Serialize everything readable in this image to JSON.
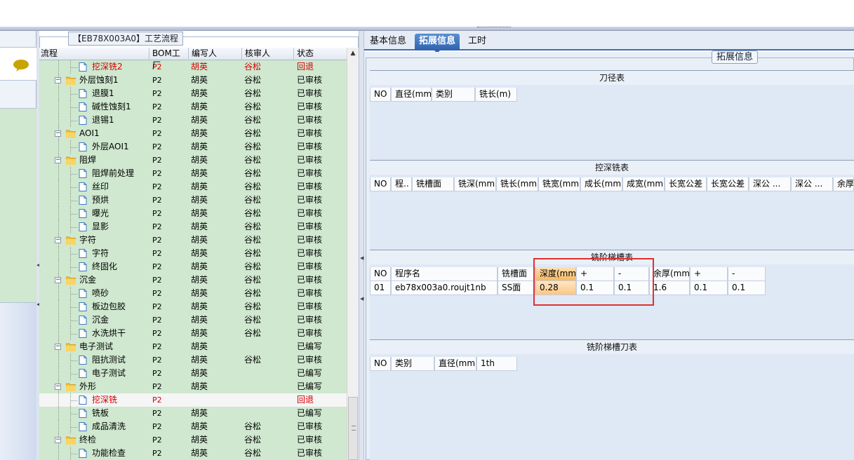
{
  "tree_panel": {
    "group_title": "【EB78X003A0】工艺流程",
    "columns": [
      "流程",
      "BOM工厂",
      "编写人",
      "核审人",
      "状态"
    ],
    "rows": [
      {
        "name": "挖深铣2",
        "level": 2,
        "type": "doc",
        "factory": "P2",
        "writer": "胡英",
        "reviewer": "谷松",
        "status": "回退",
        "red": true
      },
      {
        "name": "外层蚀刻1",
        "level": 1,
        "type": "folder",
        "factory": "P2",
        "writer": "胡英",
        "reviewer": "谷松",
        "status": "已审核"
      },
      {
        "name": "退膜1",
        "level": 2,
        "type": "doc",
        "factory": "P2",
        "writer": "胡英",
        "reviewer": "谷松",
        "status": "已审核"
      },
      {
        "name": "碱性蚀刻1",
        "level": 2,
        "type": "doc",
        "factory": "P2",
        "writer": "胡英",
        "reviewer": "谷松",
        "status": "已审核"
      },
      {
        "name": "退锡1",
        "level": 2,
        "type": "doc",
        "factory": "P2",
        "writer": "胡英",
        "reviewer": "谷松",
        "status": "已审核"
      },
      {
        "name": "AOI1",
        "level": 1,
        "type": "folder",
        "factory": "P2",
        "writer": "胡英",
        "reviewer": "谷松",
        "status": "已审核"
      },
      {
        "name": "外层AOI1",
        "level": 2,
        "type": "doc",
        "factory": "P2",
        "writer": "胡英",
        "reviewer": "谷松",
        "status": "已审核"
      },
      {
        "name": "阻焊",
        "level": 1,
        "type": "folder",
        "factory": "P2",
        "writer": "胡英",
        "reviewer": "谷松",
        "status": "已审核"
      },
      {
        "name": "阻焊前处理",
        "level": 2,
        "type": "doc",
        "factory": "P2",
        "writer": "胡英",
        "reviewer": "谷松",
        "status": "已审核"
      },
      {
        "name": "丝印",
        "level": 2,
        "type": "doc",
        "factory": "P2",
        "writer": "胡英",
        "reviewer": "谷松",
        "status": "已审核"
      },
      {
        "name": "预烘",
        "level": 2,
        "type": "doc",
        "factory": "P2",
        "writer": "胡英",
        "reviewer": "谷松",
        "status": "已审核"
      },
      {
        "name": "曝光",
        "level": 2,
        "type": "doc",
        "factory": "P2",
        "writer": "胡英",
        "reviewer": "谷松",
        "status": "已审核"
      },
      {
        "name": "显影",
        "level": 2,
        "type": "doc",
        "factory": "P2",
        "writer": "胡英",
        "reviewer": "谷松",
        "status": "已审核"
      },
      {
        "name": "字符",
        "level": 1,
        "type": "folder",
        "factory": "P2",
        "writer": "胡英",
        "reviewer": "谷松",
        "status": "已审核"
      },
      {
        "name": "字符",
        "level": 2,
        "type": "doc",
        "factory": "P2",
        "writer": "胡英",
        "reviewer": "谷松",
        "status": "已审核"
      },
      {
        "name": "终固化",
        "level": 2,
        "type": "doc",
        "factory": "P2",
        "writer": "胡英",
        "reviewer": "谷松",
        "status": "已审核"
      },
      {
        "name": "沉金",
        "level": 1,
        "type": "folder",
        "factory": "P2",
        "writer": "胡英",
        "reviewer": "谷松",
        "status": "已审核"
      },
      {
        "name": "喷砂",
        "level": 2,
        "type": "doc",
        "factory": "P2",
        "writer": "胡英",
        "reviewer": "谷松",
        "status": "已审核"
      },
      {
        "name": "板边包胶",
        "level": 2,
        "type": "doc",
        "factory": "P2",
        "writer": "胡英",
        "reviewer": "谷松",
        "status": "已审核"
      },
      {
        "name": "沉金",
        "level": 2,
        "type": "doc",
        "factory": "P2",
        "writer": "胡英",
        "reviewer": "谷松",
        "status": "已审核"
      },
      {
        "name": "水洗烘干",
        "level": 2,
        "type": "doc",
        "factory": "P2",
        "writer": "胡英",
        "reviewer": "谷松",
        "status": "已审核"
      },
      {
        "name": "电子测试",
        "level": 1,
        "type": "folder",
        "factory": "P2",
        "writer": "胡英",
        "reviewer": "",
        "status": "已编写"
      },
      {
        "name": "阻抗测试",
        "level": 2,
        "type": "doc",
        "factory": "P2",
        "writer": "胡英",
        "reviewer": "谷松",
        "status": "已审核"
      },
      {
        "name": "电子测试",
        "level": 2,
        "type": "doc",
        "factory": "P2",
        "writer": "胡英",
        "reviewer": "",
        "status": "已编写"
      },
      {
        "name": "外形",
        "level": 1,
        "type": "folder",
        "factory": "P2",
        "writer": "胡英",
        "reviewer": "",
        "status": "已编写"
      },
      {
        "name": "挖深铣",
        "level": 2,
        "type": "doc",
        "factory": "P2",
        "writer": "",
        "reviewer": "",
        "status": "回退",
        "red": true,
        "selected": true
      },
      {
        "name": "铣板",
        "level": 2,
        "type": "doc",
        "factory": "P2",
        "writer": "胡英",
        "reviewer": "",
        "status": "已编写"
      },
      {
        "name": "成品清洗",
        "level": 2,
        "type": "doc",
        "factory": "P2",
        "writer": "胡英",
        "reviewer": "谷松",
        "status": "已审核"
      },
      {
        "name": "终检",
        "level": 1,
        "type": "folder",
        "factory": "P2",
        "writer": "胡英",
        "reviewer": "谷松",
        "status": "已审核"
      },
      {
        "name": "功能检查",
        "level": 2,
        "type": "doc",
        "factory": "P2",
        "writer": "胡英",
        "reviewer": "谷松",
        "status": "已审核"
      }
    ]
  },
  "tabs": [
    "基本信息",
    "拓展信息",
    "工时"
  ],
  "active_tab": "拓展信息",
  "ext_legend": "拓展信息",
  "sections": {
    "tool_diameter": {
      "title": "刀径表",
      "headers": [
        "NO",
        "直径(mm)",
        "类别",
        "铣长(m)"
      ]
    },
    "deep_milling": {
      "title": "控深铣表",
      "headers": [
        "NO",
        "程..",
        "铣槽面",
        "铣深(mm)",
        "铣长(mm)",
        "铣宽(mm)",
        "成长(mm)",
        "成宽(mm)",
        "长宽公差",
        "长宽公差",
        "深公 ...",
        "深公 ...",
        "余厚"
      ]
    },
    "step_slot": {
      "title": "铣阶梯槽表",
      "headers": [
        "NO",
        "程序名",
        "铣槽面",
        "深度(mm)",
        "+",
        "-",
        "余厚(mm)",
        "+",
        "-"
      ],
      "rows": [
        [
          "01",
          "eb78x003a0.roujt1nb",
          "SS面",
          "0.28",
          "0.1",
          "0.1",
          "1.6",
          "0.1",
          "0.1"
        ]
      ]
    },
    "step_slot_tool": {
      "title": "铣阶梯槽刀表",
      "headers": [
        "NO",
        "类别",
        "直径(mm)",
        "1th"
      ]
    }
  },
  "colors": {
    "tree_bg": "#cfe8cf",
    "red_status": "#d40000",
    "active_tab": "#2f62ae",
    "highlight_box": "#e03030"
  }
}
